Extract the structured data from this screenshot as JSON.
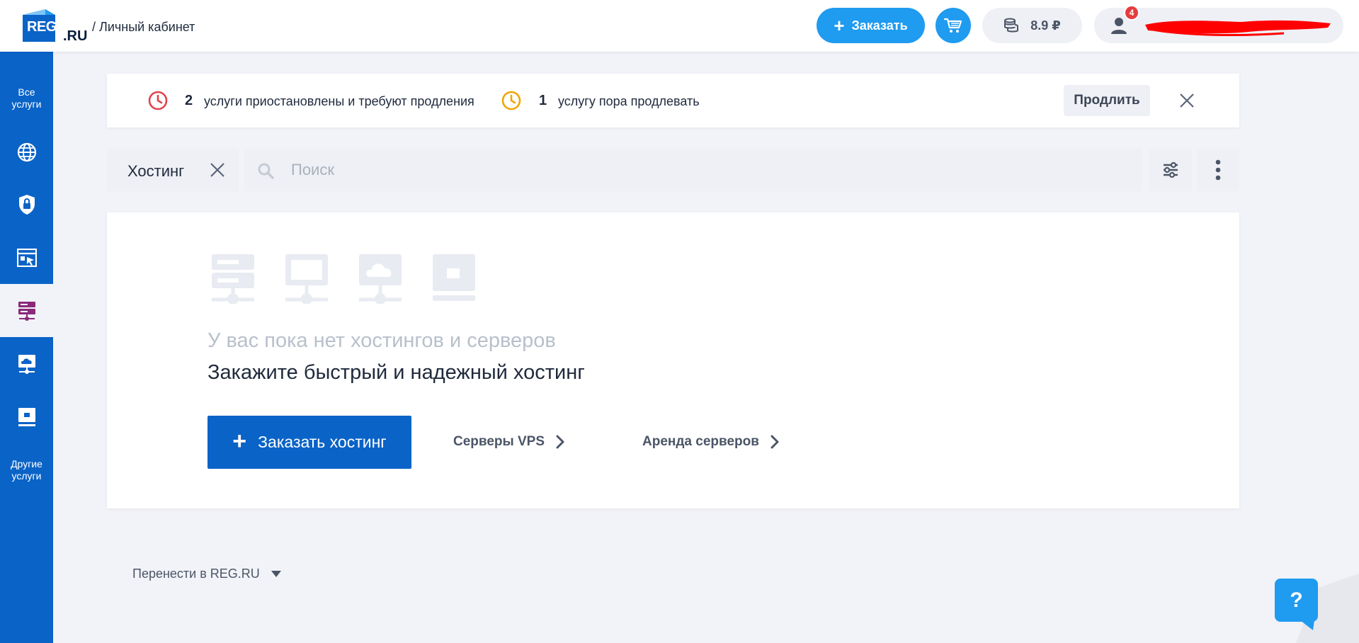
{
  "header": {
    "logo_reg": "REG",
    "logo_ru": ".RU",
    "breadcrumb": "/ Личный кабинет",
    "order_label": "Заказать",
    "balance": "8.9 ₽",
    "notifications_count": "4"
  },
  "sidebar": {
    "items": [
      {
        "label": "Все\nуслуги",
        "icon": "grid-icon"
      },
      {
        "icon": "globe-icon"
      },
      {
        "icon": "shield-lock-icon"
      },
      {
        "icon": "website-builder-icon"
      },
      {
        "icon": "hosting-icon",
        "active": true
      },
      {
        "icon": "cloud-server-icon"
      },
      {
        "icon": "dedicated-server-icon"
      },
      {
        "label": "Другие\nуслуги"
      }
    ]
  },
  "notice": {
    "suspended_count": "2",
    "suspended_text": "услуги приостановлены и требуют продления",
    "renew_due_count": "1",
    "renew_due_text": "услугу пора продлевать",
    "renew_button": "Продлить"
  },
  "filter": {
    "chip_label": "Хостинг",
    "search_placeholder": "Поиск"
  },
  "empty_state": {
    "title": "У вас пока нет хостингов и серверов",
    "subtitle": "Закажите быстрый и надежный хостинг",
    "order_button": "Заказать хостинг",
    "link_vps": "Серверы VPS",
    "link_rent": "Аренда серверов"
  },
  "footer": {
    "transfer_label": "Перенести в REG.RU"
  },
  "help": {
    "label": "?"
  },
  "colors": {
    "brand_blue": "#0a63c7",
    "accent_blue": "#1f9bf0",
    "alert_red": "#e0434b",
    "warning_orange": "#f0a500",
    "active_icon_purple": "#8a2a7a"
  }
}
